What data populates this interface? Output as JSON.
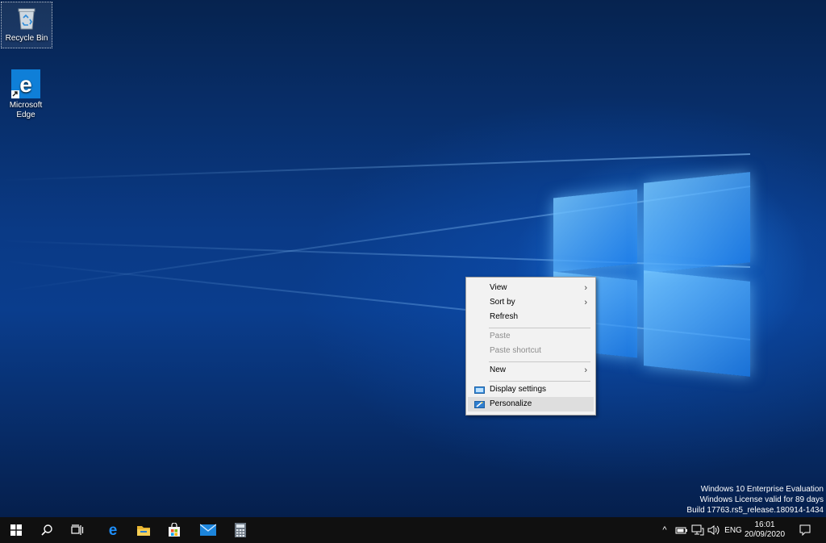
{
  "desktop": {
    "icons": [
      {
        "label": "Recycle Bin",
        "icon": "recycle-bin-icon"
      },
      {
        "label": "Microsoft Edge",
        "icon": "edge-icon"
      }
    ]
  },
  "context_menu": {
    "items": {
      "view": "View",
      "sort_by": "Sort by",
      "refresh": "Refresh",
      "paste": "Paste",
      "paste_shortcut": "Paste shortcut",
      "new": "New",
      "display_settings": "Display settings",
      "personalize": "Personalize"
    },
    "submenu_arrow": "›"
  },
  "watermark": {
    "line1": "Windows 10 Enterprise Evaluation",
    "line2": "Windows License valid for 89 days",
    "line3": "Build 17763.rs5_release.180914-1434"
  },
  "taskbar": {
    "pinned": [
      "start-icon",
      "search-icon",
      "task-view-icon",
      "edge-icon",
      "file-explorer-icon",
      "store-icon",
      "mail-icon",
      "calculator-icon"
    ],
    "tray": {
      "show_hidden": "^",
      "language": "ENG",
      "time": "16:01",
      "date": "20/09/2020"
    }
  },
  "colors": {
    "accent": "#0078d7",
    "taskbar": "#101010",
    "menu_bg": "#f2f2f2"
  }
}
